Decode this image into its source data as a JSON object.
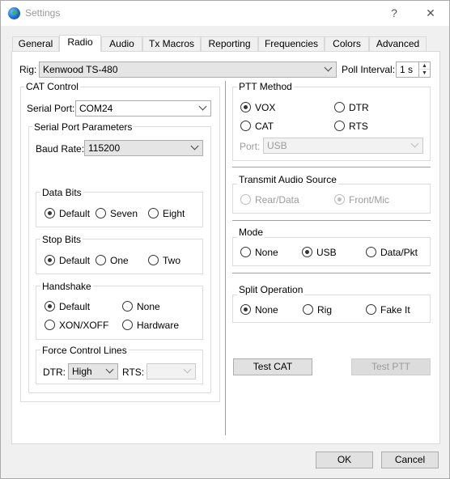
{
  "window": {
    "title": "Settings",
    "help_glyph": "?",
    "close_glyph": "✕"
  },
  "tabs": [
    {
      "label": "General"
    },
    {
      "label": "Radio"
    },
    {
      "label": "Audio"
    },
    {
      "label": "Tx Macros"
    },
    {
      "label": "Reporting"
    },
    {
      "label": "Frequencies"
    },
    {
      "label": "Colors"
    },
    {
      "label": "Advanced"
    }
  ],
  "active_tab": "Radio",
  "rig": {
    "label": "Rig:",
    "value": "Kenwood TS-480"
  },
  "poll_interval": {
    "label": "Poll Interval:",
    "value": "1 s"
  },
  "cat_control": {
    "title": "CAT Control",
    "serial_port": {
      "label": "Serial Port:",
      "value": "COM24"
    },
    "serial_params": {
      "title": "Serial Port Parameters",
      "baud_rate": {
        "label": "Baud Rate:",
        "value": "115200"
      },
      "data_bits": {
        "title": "Data Bits",
        "options": [
          "Default",
          "Seven",
          "Eight"
        ],
        "selected": "Default"
      },
      "stop_bits": {
        "title": "Stop Bits",
        "options": [
          "Default",
          "One",
          "Two"
        ],
        "selected": "Default"
      },
      "handshake": {
        "title": "Handshake",
        "options": [
          "Default",
          "None",
          "XON/XOFF",
          "Hardware"
        ],
        "selected": "Default"
      },
      "force_control": {
        "title": "Force Control Lines",
        "dtr": {
          "label": "DTR:",
          "value": "High"
        },
        "rts": {
          "label": "RTS:",
          "value": ""
        }
      }
    }
  },
  "ptt_method": {
    "title": "PTT Method",
    "options": [
      "VOX",
      "DTR",
      "CAT",
      "RTS"
    ],
    "selected": "VOX",
    "port": {
      "label": "Port:",
      "value": "USB"
    }
  },
  "transmit_audio_source": {
    "title": "Transmit Audio Source",
    "options": [
      "Rear/Data",
      "Front/Mic"
    ],
    "selected": "Front/Mic"
  },
  "mode": {
    "title": "Mode",
    "options": [
      "None",
      "USB",
      "Data/Pkt"
    ],
    "selected": "USB"
  },
  "split_operation": {
    "title": "Split Operation",
    "options": [
      "None",
      "Rig",
      "Fake It"
    ],
    "selected": "None"
  },
  "buttons": {
    "test_cat": "Test CAT",
    "test_ptt": "Test PTT",
    "ok": "OK",
    "cancel": "Cancel"
  }
}
